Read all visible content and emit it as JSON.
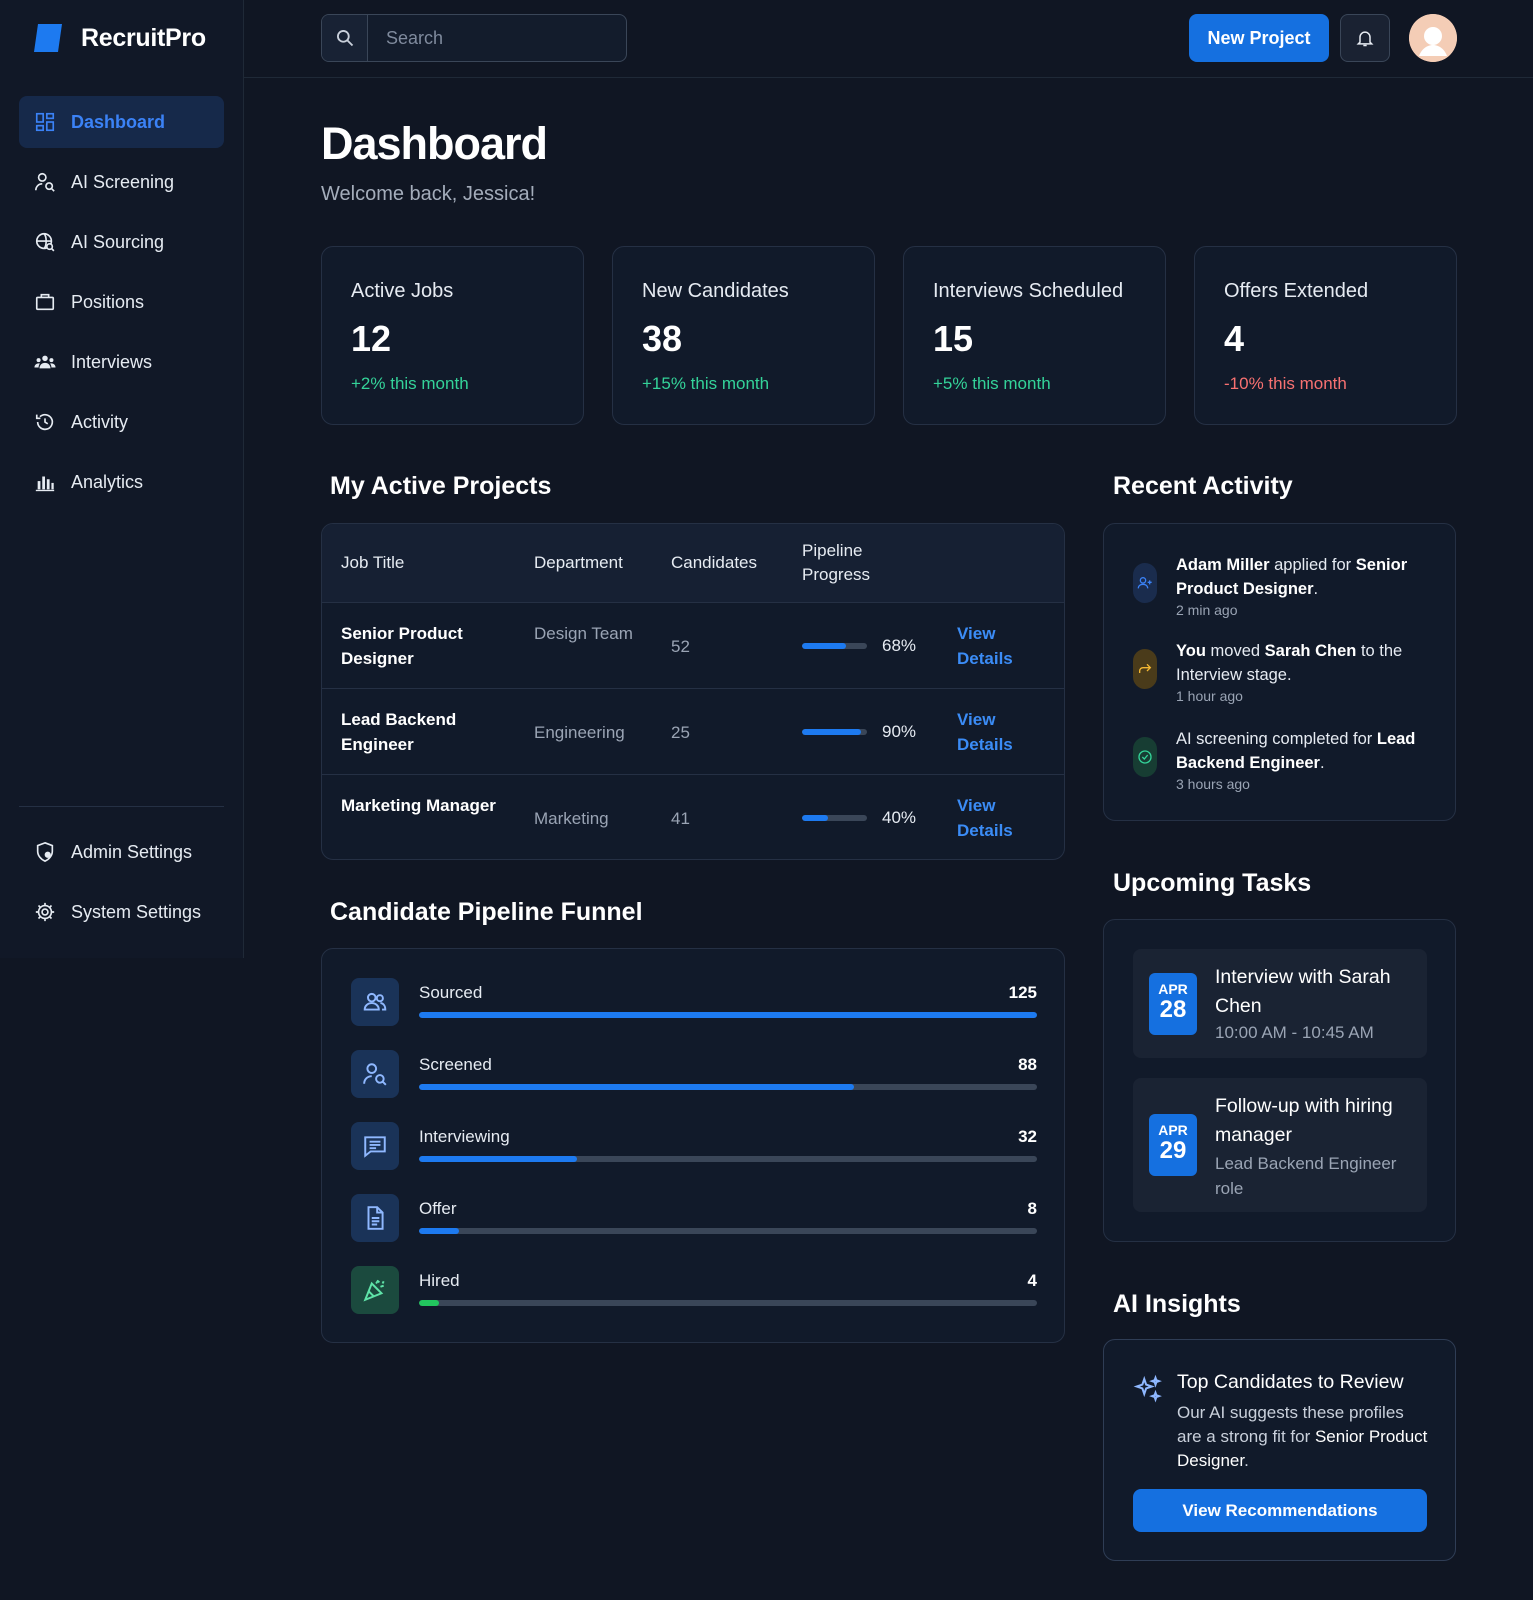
{
  "brand": {
    "name": "RecruitPro",
    "color": "#1d7af0"
  },
  "sidebar": {
    "items": [
      {
        "label": "Dashboard",
        "icon": "dashboard-icon",
        "active": true
      },
      {
        "label": "AI Screening",
        "icon": "user-search-icon"
      },
      {
        "label": "AI Sourcing",
        "icon": "globe-search-icon"
      },
      {
        "label": "Positions",
        "icon": "briefcase-icon"
      },
      {
        "label": "Interviews",
        "icon": "people-icon"
      },
      {
        "label": "Activity",
        "icon": "history-icon"
      },
      {
        "label": "Analytics",
        "icon": "bar-chart-icon"
      }
    ],
    "bottom_items": [
      {
        "label": "Admin Settings",
        "icon": "shield-user-icon"
      },
      {
        "label": "System Settings",
        "icon": "gear-icon"
      }
    ]
  },
  "header": {
    "search_placeholder": "Search",
    "new_project_label": "New Project"
  },
  "page": {
    "title": "Dashboard",
    "subtitle": "Welcome back, Jessica!"
  },
  "stats": [
    {
      "label": "Active Jobs",
      "value": "12",
      "delta": "+2% this month",
      "trend": "up"
    },
    {
      "label": "New Candidates",
      "value": "38",
      "delta": "+15% this month",
      "trend": "up"
    },
    {
      "label": "Interviews Scheduled",
      "value": "15",
      "delta": "+5% this month",
      "trend": "up"
    },
    {
      "label": "Offers Extended",
      "value": "4",
      "delta": "-10% this month",
      "trend": "down"
    }
  ],
  "projects": {
    "title": "My Active Projects",
    "columns": [
      "Job Title",
      "Department",
      "Candidates",
      "Pipeline Progress"
    ],
    "rows": [
      {
        "title": "Senior Product Designer",
        "department": "Design Team",
        "candidates": "52",
        "progress": 68,
        "progress_label": "68%",
        "link": "View Details"
      },
      {
        "title": "Lead Backend Engineer",
        "department": "Engineering",
        "candidates": "25",
        "progress": 90,
        "progress_label": "90%",
        "link": "View Details"
      },
      {
        "title": "Marketing Manager",
        "department": "Marketing",
        "candidates": "41",
        "progress": 40,
        "progress_label": "40%",
        "link": "View Details"
      }
    ]
  },
  "funnel": {
    "title": "Candidate Pipeline Funnel",
    "max": 125,
    "stages": [
      {
        "label": "Sourced",
        "count": "125",
        "value": 125,
        "icon": "users-icon"
      },
      {
        "label": "Screened",
        "count": "88",
        "value": 88,
        "icon": "user-search-icon"
      },
      {
        "label": "Interviewing",
        "count": "32",
        "value": 32,
        "icon": "chat-icon"
      },
      {
        "label": "Offer",
        "count": "8",
        "value": 8,
        "icon": "document-icon"
      },
      {
        "label": "Hired",
        "count": "4",
        "value": 4,
        "icon": "celebration-icon",
        "accent": "green"
      }
    ]
  },
  "activity": {
    "title": "Recent Activity",
    "items": [
      {
        "actor": "Adam Miller",
        "text": " applied for ",
        "target": "Senior Product Designer",
        "end": ".",
        "time": "2 min ago",
        "icon": "user-plus-icon",
        "color": "#3b82f6"
      },
      {
        "actor": "You",
        "text": " moved ",
        "target": "Sarah Chen",
        "end": " to the Interview stage.",
        "time": "1 hour ago",
        "icon": "forward-icon",
        "color": "#f5b833"
      },
      {
        "actor": "",
        "text": "AI screening completed for ",
        "target": "Lead Backend Engineer",
        "end": ".",
        "time": "3 hours ago",
        "icon": "check-circle-icon",
        "color": "#34d399"
      }
    ]
  },
  "tasks": {
    "title": "Upcoming Tasks",
    "items": [
      {
        "month": "APR",
        "day": "28",
        "title": "Interview with Sarah Chen",
        "subtitle": "10:00 AM - 10:45 AM"
      },
      {
        "month": "APR",
        "day": "29",
        "title": "Follow-up with hiring manager",
        "subtitle": "Lead Backend Engineer role"
      }
    ]
  },
  "insights": {
    "title": "AI Insights",
    "card_title": "Top Candidates to Review",
    "text": "Our AI suggests these profiles are a strong fit for ",
    "target": "Senior Product Designer",
    "end": ".",
    "button_label": "View Recommendations"
  }
}
